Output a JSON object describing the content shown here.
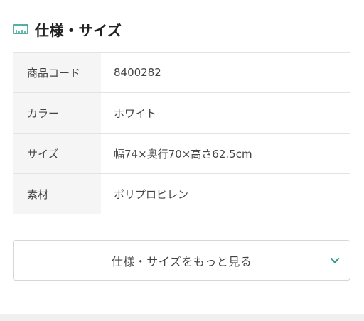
{
  "section": {
    "title": "仕様・サイズ",
    "icon": "ruler-icon",
    "icon_color": "#2a9d8f"
  },
  "specs": [
    {
      "label": "商品コード",
      "value": "8400282"
    },
    {
      "label": "カラー",
      "value": "ホワイト"
    },
    {
      "label": "サイズ",
      "value": "幅74×奥行70×高さ62.5cm"
    },
    {
      "label": "素材",
      "value": "ポリプロピレン"
    }
  ],
  "more_button": {
    "label": "仕様・サイズをもっと見る",
    "icon": "chevron-down-icon",
    "icon_color": "#2a9d8f"
  }
}
